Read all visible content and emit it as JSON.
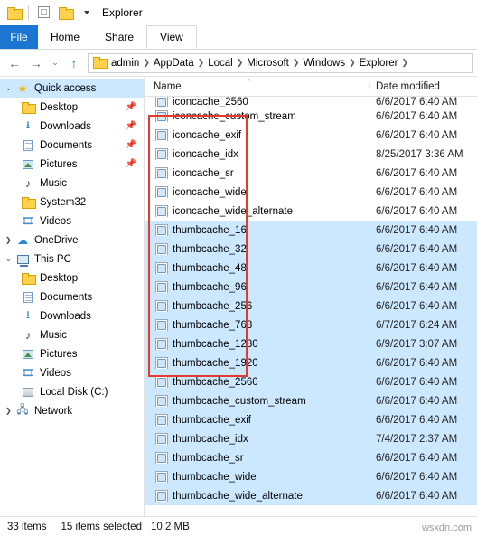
{
  "window": {
    "title": "Explorer",
    "quick_access_icons": [
      "folder-icon",
      "save-icon",
      "folder-icon",
      "customize-caret-icon"
    ]
  },
  "ribbon": {
    "tabs": [
      {
        "label": "File",
        "type": "file"
      },
      {
        "label": "Home",
        "type": "normal"
      },
      {
        "label": "Share",
        "type": "normal"
      },
      {
        "label": "View",
        "type": "active"
      }
    ]
  },
  "address": {
    "back_icon": "back-arrow-icon",
    "forward_icon": "forward-arrow-icon",
    "recent_icon": "chevron-down-icon",
    "up_icon": "up-arrow-icon",
    "folder_icon": "folder-icon",
    "crumbs": [
      "admin",
      "AppData",
      "Local",
      "Microsoft",
      "Windows",
      "Explorer"
    ],
    "trailing_sep": ">",
    "dropdown_icon": "chevron-down-icon"
  },
  "sidebar": {
    "items": [
      {
        "label": "Quick access",
        "icon": "star-icon",
        "level": 0,
        "selected": true
      },
      {
        "label": "Desktop",
        "icon": "folder-icon",
        "level": 1,
        "pin": "pin-icon"
      },
      {
        "label": "Downloads",
        "icon": "download-icon",
        "level": 1,
        "pin": "pin-icon"
      },
      {
        "label": "Documents",
        "icon": "document-icon",
        "level": 1,
        "pin": "pin-icon"
      },
      {
        "label": "Pictures",
        "icon": "picture-icon",
        "level": 1,
        "pin": "pin-icon"
      },
      {
        "label": "Music",
        "icon": "music-icon",
        "level": 1
      },
      {
        "label": "System32",
        "icon": "folder-icon",
        "level": 1
      },
      {
        "label": "Videos",
        "icon": "video-icon",
        "level": 1
      },
      {
        "label": "OneDrive",
        "icon": "cloud-icon",
        "level": 0
      },
      {
        "label": "This PC",
        "icon": "computer-icon",
        "level": 0
      },
      {
        "label": "Desktop",
        "icon": "folder-icon",
        "level": 1
      },
      {
        "label": "Documents",
        "icon": "document-icon",
        "level": 1
      },
      {
        "label": "Downloads",
        "icon": "download-icon",
        "level": 1
      },
      {
        "label": "Music",
        "icon": "music-icon",
        "level": 1
      },
      {
        "label": "Pictures",
        "icon": "picture-icon",
        "level": 1
      },
      {
        "label": "Videos",
        "icon": "video-icon",
        "level": 1
      },
      {
        "label": "Local Disk (C:)",
        "icon": "disk-icon",
        "level": 1
      },
      {
        "label": "Network",
        "icon": "network-icon",
        "level": 0
      }
    ]
  },
  "filelist": {
    "columns": [
      {
        "label": "Name",
        "sorted": true,
        "sort_arrow": "sort-ascending-icon"
      },
      {
        "label": "Date modified"
      }
    ],
    "rows": [
      {
        "name": "iconcache_2560",
        "date": "6/6/2017 6:40 AM",
        "icon": "database-file-icon",
        "selected": false,
        "clipped": true
      },
      {
        "name": "iconcache_custom_stream",
        "date": "6/6/2017 6:40 AM",
        "icon": "database-file-icon",
        "selected": false
      },
      {
        "name": "iconcache_exif",
        "date": "6/6/2017 6:40 AM",
        "icon": "database-file-icon",
        "selected": false
      },
      {
        "name": "iconcache_idx",
        "date": "8/25/2017 3:36 AM",
        "icon": "database-file-icon",
        "selected": false
      },
      {
        "name": "iconcache_sr",
        "date": "6/6/2017 6:40 AM",
        "icon": "database-file-icon",
        "selected": false
      },
      {
        "name": "iconcache_wide",
        "date": "6/6/2017 6:40 AM",
        "icon": "database-file-icon",
        "selected": false
      },
      {
        "name": "iconcache_wide_alternate",
        "date": "6/6/2017 6:40 AM",
        "icon": "database-file-icon",
        "selected": false
      },
      {
        "name": "thumbcache_16",
        "date": "6/6/2017 6:40 AM",
        "icon": "database-file-icon",
        "selected": true
      },
      {
        "name": "thumbcache_32",
        "date": "6/6/2017 6:40 AM",
        "icon": "database-file-icon",
        "selected": true
      },
      {
        "name": "thumbcache_48",
        "date": "6/6/2017 6:40 AM",
        "icon": "database-file-icon",
        "selected": true
      },
      {
        "name": "thumbcache_96",
        "date": "6/6/2017 6:40 AM",
        "icon": "database-file-icon",
        "selected": true
      },
      {
        "name": "thumbcache_256",
        "date": "6/6/2017 6:40 AM",
        "icon": "database-file-icon",
        "selected": true
      },
      {
        "name": "thumbcache_768",
        "date": "6/7/2017 6:24 AM",
        "icon": "database-file-icon",
        "selected": true
      },
      {
        "name": "thumbcache_1280",
        "date": "6/9/2017 3:07 AM",
        "icon": "database-file-icon",
        "selected": true
      },
      {
        "name": "thumbcache_1920",
        "date": "6/6/2017 6:40 AM",
        "icon": "database-file-icon",
        "selected": true
      },
      {
        "name": "thumbcache_2560",
        "date": "6/6/2017 6:40 AM",
        "icon": "database-file-icon",
        "selected": true
      },
      {
        "name": "thumbcache_custom_stream",
        "date": "6/6/2017 6:40 AM",
        "icon": "database-file-icon",
        "selected": true
      },
      {
        "name": "thumbcache_exif",
        "date": "6/6/2017 6:40 AM",
        "icon": "database-file-icon",
        "selected": true
      },
      {
        "name": "thumbcache_idx",
        "date": "7/4/2017 2:37 AM",
        "icon": "database-file-icon",
        "selected": true
      },
      {
        "name": "thumbcache_sr",
        "date": "6/6/2017 6:40 AM",
        "icon": "database-file-icon",
        "selected": true
      },
      {
        "name": "thumbcache_wide",
        "date": "6/6/2017 6:40 AM",
        "icon": "database-file-icon",
        "selected": true
      },
      {
        "name": "thumbcache_wide_alternate",
        "date": "6/6/2017 6:40 AM",
        "icon": "database-file-icon",
        "selected": true
      }
    ]
  },
  "statusbar": {
    "item_count": "33 items",
    "selection_count": "15 items selected",
    "selection_size": "10.2 MB"
  },
  "watermark": "wsxdn.com",
  "colors": {
    "accent": "#1b76d1",
    "selection": "#cce8ff",
    "annotation": "#e23b2e"
  }
}
